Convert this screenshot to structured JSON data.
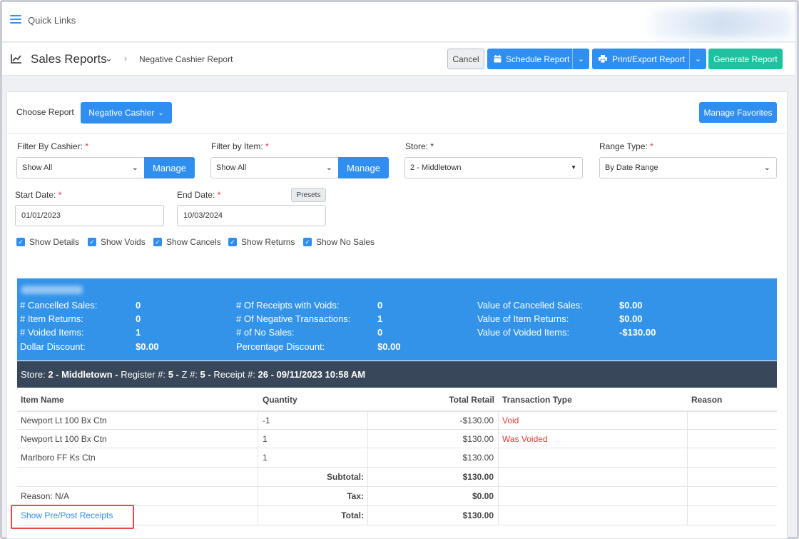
{
  "topbar": {
    "quick_links": "Quick Links"
  },
  "header": {
    "title": "Sales Reports",
    "breadcrumb": "Negative Cashier Report",
    "cancel": "Cancel",
    "schedule": "Schedule Report",
    "print": "Print/Export Report",
    "generate": "Generate Report"
  },
  "report": {
    "choose_label": "Choose Report",
    "choose_value": "Negative Cashier",
    "manage_favorites": "Manage Favorites"
  },
  "filters": {
    "cashier_label": "Filter By Cashier:",
    "cashier_value": "Show All",
    "item_label": "Filter by Item:",
    "item_value": "Show All",
    "manage": "Manage",
    "store_label": "Store:",
    "store_value": "2 - Middletown",
    "range_label": "Range Type:",
    "range_value": "By Date Range",
    "start_label": "Start Date:",
    "start_value": "01/01/2023",
    "end_label": "End Date:",
    "end_value": "10/03/2024",
    "presets": "Presets",
    "required_mark": "*"
  },
  "checkboxes": [
    "Show Details",
    "Show Voids",
    "Show Cancels",
    "Show Returns",
    "Show No Sales"
  ],
  "summary": {
    "col1": [
      {
        "label": "# Cancelled Sales:",
        "value": "0"
      },
      {
        "label": "# Item Returns:",
        "value": "0"
      },
      {
        "label": "# Voided Items:",
        "value": "1"
      },
      {
        "label": "Dollar Discount:",
        "value": "$0.00"
      }
    ],
    "col2": [
      {
        "label": "# Of Receipts with Voids:",
        "value": "0"
      },
      {
        "label": "# Of Negative Transactions:",
        "value": "1"
      },
      {
        "label": "# of No Sales:",
        "value": "0"
      },
      {
        "label": "Percentage Discount:",
        "value": "$0.00"
      }
    ],
    "col3": [
      {
        "label": "Value of Cancelled Sales:",
        "value": "$0.00"
      },
      {
        "label": "Value of Item Returns:",
        "value": "$0.00"
      },
      {
        "label": "Value of Voided Items:",
        "value": "-$130.00"
      }
    ]
  },
  "storebar": {
    "store_label": "Store:",
    "store_value": "2 - Middletown",
    "register_label": "Register #:",
    "register_value": "5",
    "z_label": "Z #:",
    "z_value": "5",
    "receipt_label": "Receipt #:",
    "receipt_value": "26 - 09/11/2023 10:58 AM"
  },
  "table": {
    "headers": [
      "Item Name",
      "Quantity",
      "Total Retail",
      "Transaction Type",
      "Reason"
    ],
    "rows": [
      {
        "name": "Newport Lt 100 Bx Ctn",
        "qty": "-1",
        "retail": "-$130.00",
        "type": "Void"
      },
      {
        "name": "Newport Lt 100 Bx Ctn",
        "qty": "1",
        "retail": "$130.00",
        "type": "Was Voided"
      },
      {
        "name": "Marlboro FF Ks Ctn",
        "qty": "1",
        "retail": "$130.00",
        "type": ""
      }
    ],
    "subtotal_label": "Subtotal:",
    "subtotal_value": "$130.00",
    "reason_label": "Reason:",
    "reason_value": "N/A",
    "tax_label": "Tax:",
    "tax_value": "$0.00",
    "show_receipts": "Show Pre/Post Receipts",
    "total_label": "Total:",
    "total_value": "$130.00"
  },
  "colors": {
    "accent": "#2f8ef0",
    "green": "#1fc1a0",
    "summary_bg": "#3293e8",
    "store_bar": "#39475a",
    "void_red": "#e53935"
  }
}
